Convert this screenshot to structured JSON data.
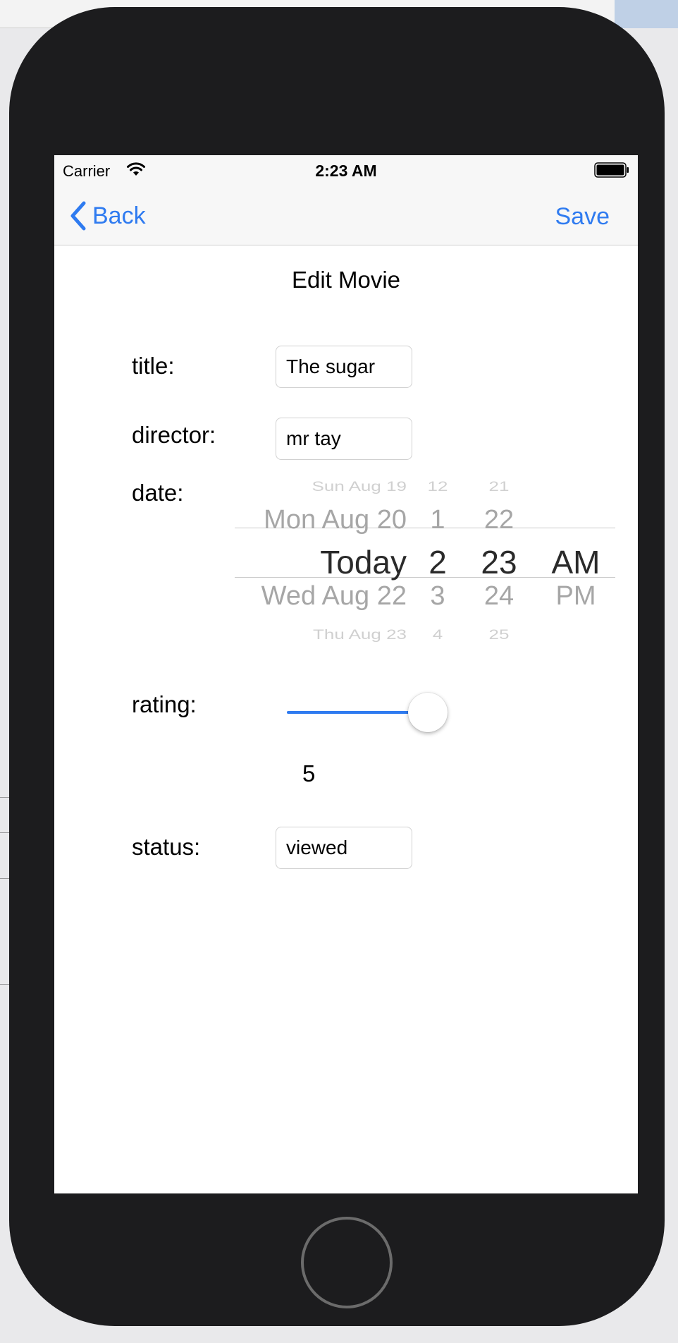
{
  "status_bar": {
    "carrier": "Carrier",
    "time": "2:23 AM"
  },
  "nav": {
    "back_label": "Back",
    "save_label": "Save",
    "accent_color": "#2f7bf0"
  },
  "page": {
    "title": "Edit Movie"
  },
  "form": {
    "title_label": "title:",
    "title_value": "The sugar",
    "director_label": "director:",
    "director_value": "mr tay",
    "date_label": "date:",
    "rating_label": "rating:",
    "rating_value": "5",
    "rating_fraction": 1.0,
    "status_label": "status:",
    "status_value": "viewed"
  },
  "date_picker": {
    "day": {
      "top": "Sun Aug 19",
      "up": "Mon Aug 20",
      "selected": "Today",
      "down": "Wed Aug 22",
      "bottom": "Thu Aug 23"
    },
    "hour": {
      "top": "12",
      "up": "1",
      "selected": "2",
      "down": "3",
      "bottom": "4"
    },
    "minute": {
      "top": "21",
      "up": "22",
      "selected": "23",
      "down": "24",
      "bottom": "25"
    },
    "ampm": {
      "selected": "AM",
      "down": "PM"
    }
  }
}
